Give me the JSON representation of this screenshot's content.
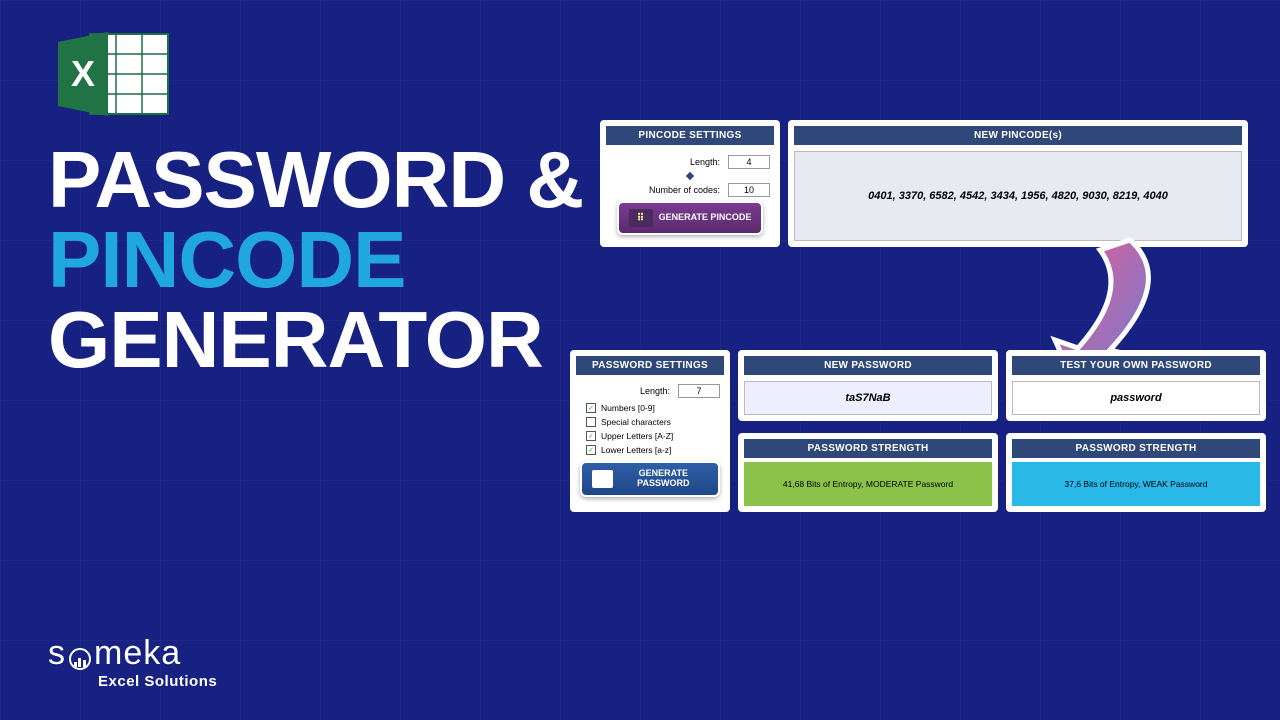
{
  "title": {
    "l1": "PASSWORD &",
    "l2": "PINCODE",
    "l3": "GENERATOR"
  },
  "brand": {
    "name_pre": "s",
    "name_post": "meka",
    "sub": "Excel Solutions"
  },
  "pincode": {
    "settings_header": "PINCODE SETTINGS",
    "length_label": "Length:",
    "length_value": "4",
    "count_label": "Number of codes:",
    "count_value": "10",
    "btn": "GENERATE PINCODE",
    "output_header": "NEW PINCODE(s)",
    "output_value": "0401, 3370, 6582, 4542, 3434, 1956, 4820, 9030, 8219, 4040"
  },
  "password": {
    "settings_header": "PASSWORD SETTINGS",
    "length_label": "Length:",
    "length_value": "7",
    "opt_numbers": "Numbers [0-9]",
    "opt_special": "Special characters",
    "opt_upper": "Upper Letters [A-Z]",
    "opt_lower": "Lower Letters [a-z]",
    "btn": "GENERATE PASSWORD",
    "new_header": "NEW PASSWORD",
    "new_value": "taS7NaB",
    "new_str_header": "PASSWORD STRENGTH",
    "new_str_value": "41,68 Bits of Entropy, MODERATE Password",
    "test_header": "TEST YOUR OWN PASSWORD",
    "test_value": "password",
    "test_str_header": "PASSWORD STRENGTH",
    "test_str_value": "37,6 Bits of Entropy, WEAK Password"
  }
}
